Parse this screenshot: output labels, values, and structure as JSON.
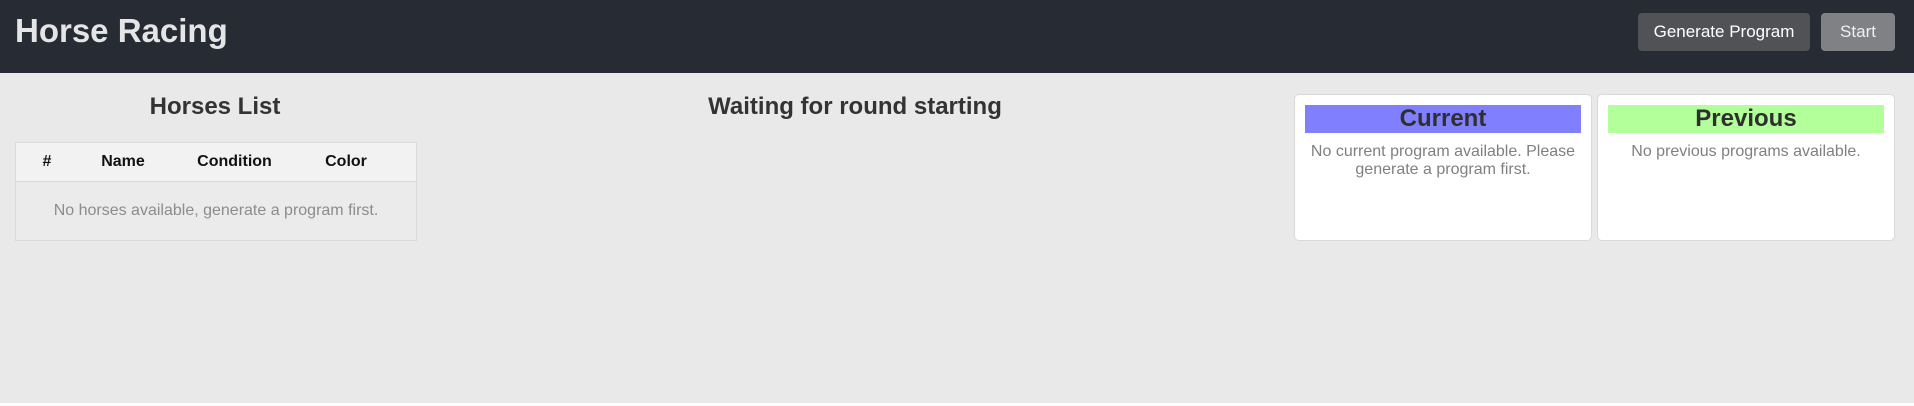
{
  "header": {
    "title": "Horse Racing",
    "generate_label": "Generate Program",
    "start_label": "Start"
  },
  "horses": {
    "title": "Horses List",
    "columns": [
      "#",
      "Name",
      "Condition",
      "Color"
    ],
    "empty_text": "No horses available, generate a program first."
  },
  "race": {
    "status_text": "Waiting for round starting"
  },
  "programs": {
    "current": {
      "title": "Current",
      "empty_text": "No current program available. Please generate a program first."
    },
    "previous": {
      "title": "Previous",
      "empty_text": "No previous programs available."
    }
  },
  "colors": {
    "header_bg": "#272b33",
    "page_bg": "#e9e9e9",
    "current_accent": "#8080ff",
    "previous_accent": "#b3ff99"
  }
}
